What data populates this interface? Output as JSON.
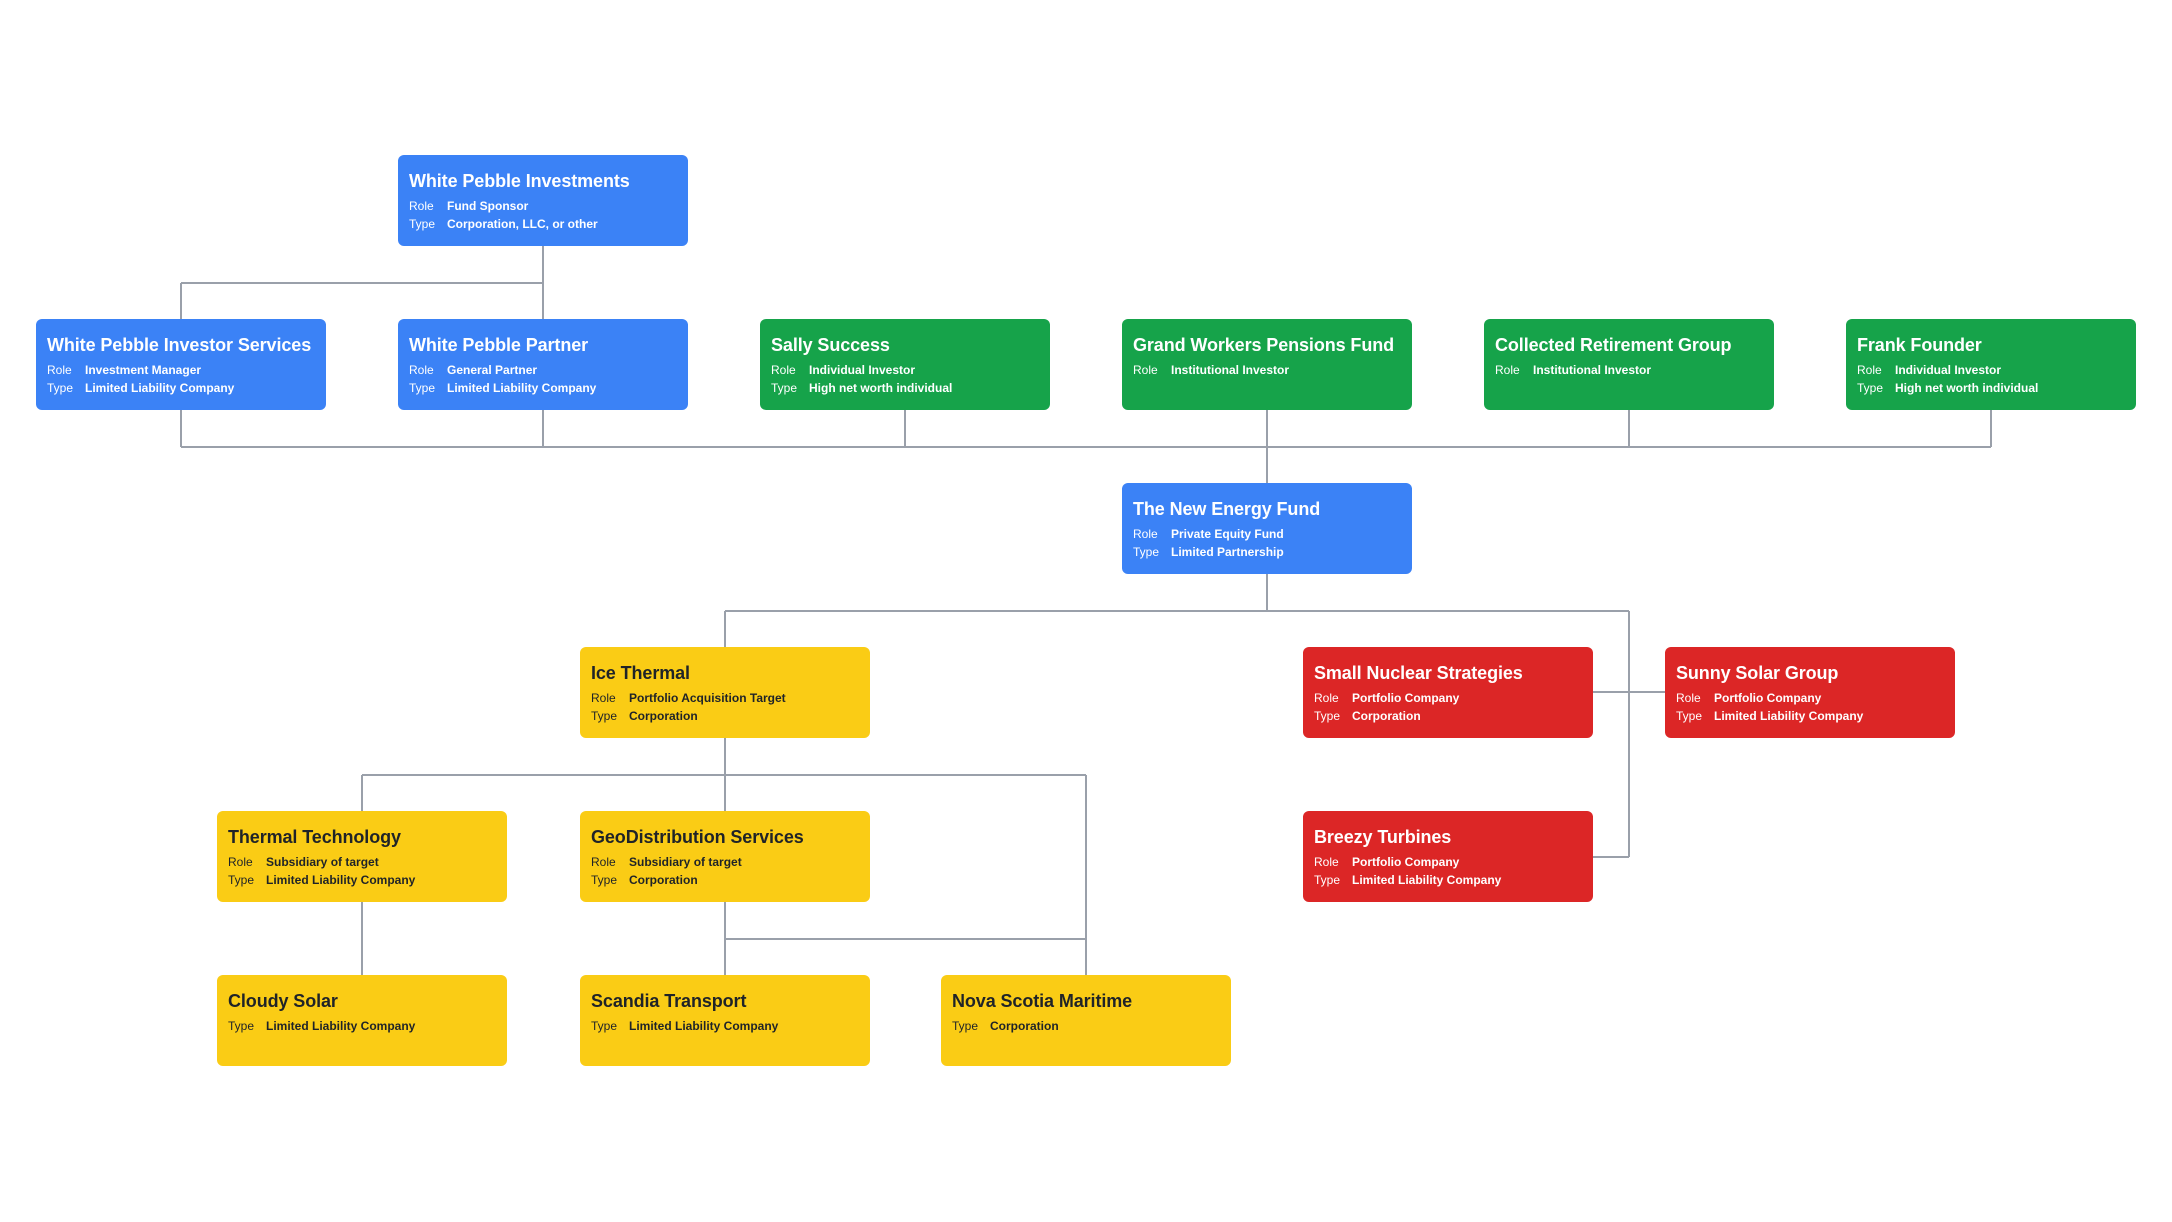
{
  "diagram": {
    "colors": {
      "fund_entity": "#3b82f6",
      "investor": "#16a34a",
      "portfolio_company": "#dc2626",
      "acquisition_target": "#facc15",
      "connector": "#9aa0aa"
    },
    "labels": {
      "role": "Role",
      "type": "Type"
    },
    "nodes": {
      "white_pebble_investments": {
        "name": "White Pebble Investments",
        "role": "Fund Sponsor",
        "type": "Corporation, LLC, or other"
      },
      "white_pebble_investor_services": {
        "name": "White Pebble Investor Services",
        "role": "Investment Manager",
        "type": "Limited Liability Company"
      },
      "white_pebble_partner": {
        "name": "White Pebble Partner",
        "role": "General Partner",
        "type": "Limited Liability Company"
      },
      "sally_success": {
        "name": "Sally Success",
        "role": "Individual Investor",
        "type": "High net worth individual"
      },
      "grand_workers_pensions_fund": {
        "name": "Grand Workers Pensions Fund",
        "role": "Institutional Investor"
      },
      "collected_retirement_group": {
        "name": "Collected Retirement Group",
        "role": "Institutional Investor"
      },
      "frank_founder": {
        "name": "Frank Founder",
        "role": "Individual Investor",
        "type": "High net worth individual"
      },
      "the_new_energy_fund": {
        "name": "The New Energy Fund",
        "role": "Private Equity Fund",
        "type": "Limited Partnership"
      },
      "ice_thermal": {
        "name": "Ice Thermal",
        "role": "Portfolio Acquisition Target",
        "type": "Corporation"
      },
      "small_nuclear_strategies": {
        "name": "Small Nuclear Strategies",
        "role": "Portfolio Company",
        "type": "Corporation"
      },
      "sunny_solar_group": {
        "name": "Sunny Solar Group",
        "role": "Portfolio Company",
        "type": "Limited Liability Company"
      },
      "thermal_technology": {
        "name": "Thermal Technology",
        "role": "Subsidiary of target",
        "type": "Limited Liability Company"
      },
      "geodistribution_services": {
        "name": "GeoDistribution Services",
        "role": "Subsidiary of target",
        "type": "Corporation"
      },
      "breezy_turbines": {
        "name": "Breezy Turbines",
        "role": "Portfolio Company",
        "type": "Limited Liability Company"
      },
      "cloudy_solar": {
        "name": "Cloudy Solar",
        "type": "Limited Liability Company"
      },
      "scandia_transport": {
        "name": "Scandia Transport",
        "type": "Limited Liability Company"
      },
      "nova_scotia_maritime": {
        "name": "Nova Scotia Maritime",
        "type": "Corporation"
      }
    },
    "edges": [
      [
        "white_pebble_investments",
        "white_pebble_investor_services"
      ],
      [
        "white_pebble_investments",
        "white_pebble_partner"
      ],
      [
        "white_pebble_investor_services",
        "the_new_energy_fund"
      ],
      [
        "white_pebble_partner",
        "the_new_energy_fund"
      ],
      [
        "sally_success",
        "the_new_energy_fund"
      ],
      [
        "grand_workers_pensions_fund",
        "the_new_energy_fund"
      ],
      [
        "collected_retirement_group",
        "the_new_energy_fund"
      ],
      [
        "frank_founder",
        "the_new_energy_fund"
      ],
      [
        "the_new_energy_fund",
        "ice_thermal"
      ],
      [
        "the_new_energy_fund",
        "small_nuclear_strategies"
      ],
      [
        "the_new_energy_fund",
        "sunny_solar_group"
      ],
      [
        "the_new_energy_fund",
        "breezy_turbines"
      ],
      [
        "ice_thermal",
        "thermal_technology"
      ],
      [
        "ice_thermal",
        "geodistribution_services"
      ],
      [
        "ice_thermal",
        "nova_scotia_maritime"
      ],
      [
        "thermal_technology",
        "cloudy_solar"
      ],
      [
        "geodistribution_services",
        "scandia_transport"
      ],
      [
        "geodistribution_services",
        "nova_scotia_maritime"
      ]
    ]
  }
}
